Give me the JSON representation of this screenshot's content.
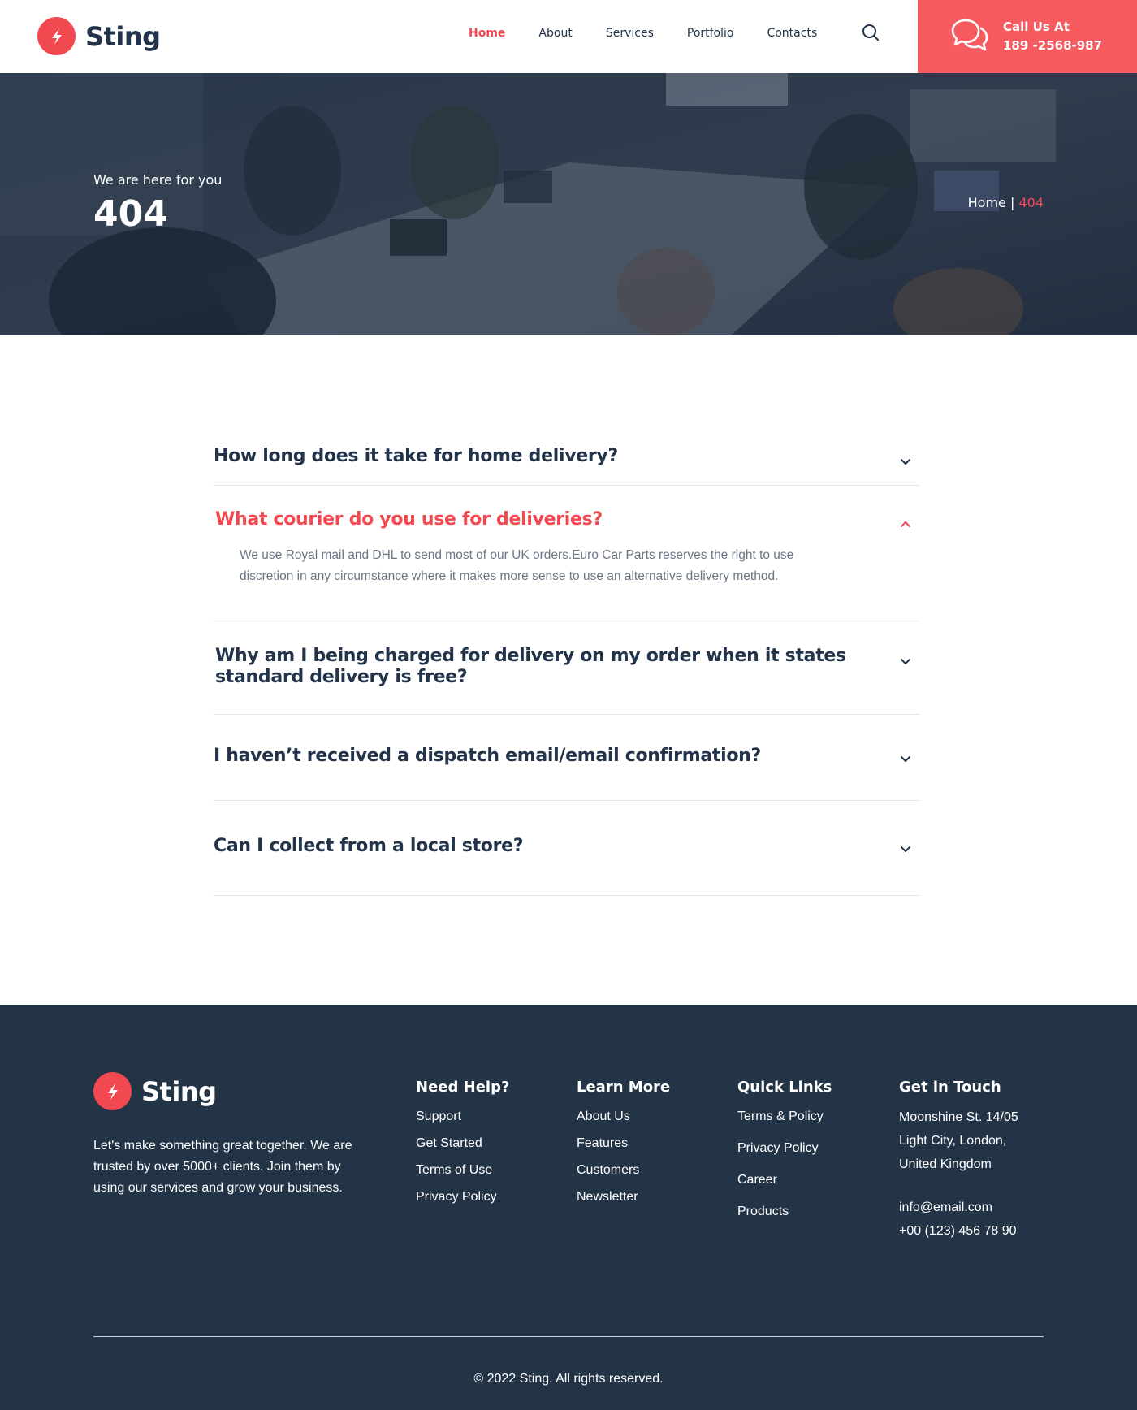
{
  "brand": {
    "name": "Sting",
    "accent": "#f2484f",
    "dark": "#243447"
  },
  "nav": {
    "items": [
      "Home",
      "About",
      "Services",
      "Portfolio",
      "Contacts"
    ],
    "active": "Home",
    "search_icon": "search-icon"
  },
  "call": {
    "title": "Call Us At",
    "phone": "189 -2568-987",
    "icon": "chat-bubbles-icon"
  },
  "hero": {
    "subtitle": "We are here for you",
    "title": "404",
    "breadcrumb": {
      "home": "Home",
      "separator": "|",
      "current": "404"
    }
  },
  "faq": [
    {
      "question": "How long does it take for home delivery?",
      "open": false
    },
    {
      "question": "What courier do you use for deliveries?",
      "open": true,
      "answer": "We use Royal mail and DHL to send most of our UK orders.Euro Car Parts reserves the right to use discretion in any circumstance where it makes more sense to use an alternative delivery method."
    },
    {
      "question": "Why am I being charged for delivery on my order when it states standard delivery is free?",
      "open": false
    },
    {
      "question": "I haven’t received a dispatch email/email confirmation?",
      "open": false
    },
    {
      "question": "Can I collect from a local store?",
      "open": false
    }
  ],
  "footer": {
    "brand": "Sting",
    "description": "Let's make something great together. We are trusted by over 5000+ clients. Join them by using our services and grow your business.",
    "columns": [
      {
        "title": "Need Help?",
        "links": [
          "Support",
          "Get Started",
          "Terms of Use",
          "Privacy Policy"
        ]
      },
      {
        "title": "Learn More",
        "links": [
          "About Us",
          "Features",
          "Customers",
          "Newsletter"
        ]
      },
      {
        "title": "Quick Links",
        "links": [
          "Terms & Policy",
          "Privacy Policy",
          "Career",
          "Products"
        ]
      }
    ],
    "contact": {
      "title": "Get in Touch",
      "address": [
        "Moonshine St. 14/05",
        "Light City, London,",
        "United Kingdom"
      ],
      "email": "info@email.com",
      "phone": "+00 (123) 456 78 90"
    },
    "copyright": "© 2022 Sting. All rights reserved."
  }
}
